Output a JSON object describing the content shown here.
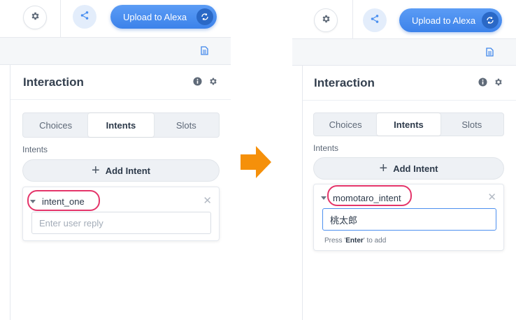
{
  "colors": {
    "accent": "#4a8ff0",
    "highlight": "#e4356a",
    "arrow": "#f5900a"
  },
  "toolbar": {
    "upload_label": "Upload to Alexa",
    "settings_icon": "gear-icon",
    "share_icon": "share-icon",
    "sync_icon": "sync-icon",
    "doc_icon": "document-icon"
  },
  "before": {
    "title": "Interaction",
    "tabs": [
      {
        "label": "Choices",
        "active": false
      },
      {
        "label": "Intents",
        "active": true
      },
      {
        "label": "Slots",
        "active": false
      }
    ],
    "section_label": "Intents",
    "add_intent_label": "Add Intent",
    "intent": {
      "name": "intent_one",
      "reply_value": "",
      "reply_placeholder": "Enter user reply"
    }
  },
  "after": {
    "title": "Interaction",
    "tabs": [
      {
        "label": "Choices",
        "active": false
      },
      {
        "label": "Intents",
        "active": true
      },
      {
        "label": "Slots",
        "active": false
      }
    ],
    "section_label": "Intents",
    "add_intent_label": "Add Intent",
    "intent": {
      "name": "momotaro_intent",
      "reply_value": "桃太郎",
      "hint_prefix": "Press '",
      "hint_key": "Enter",
      "hint_suffix": "' to add"
    }
  }
}
